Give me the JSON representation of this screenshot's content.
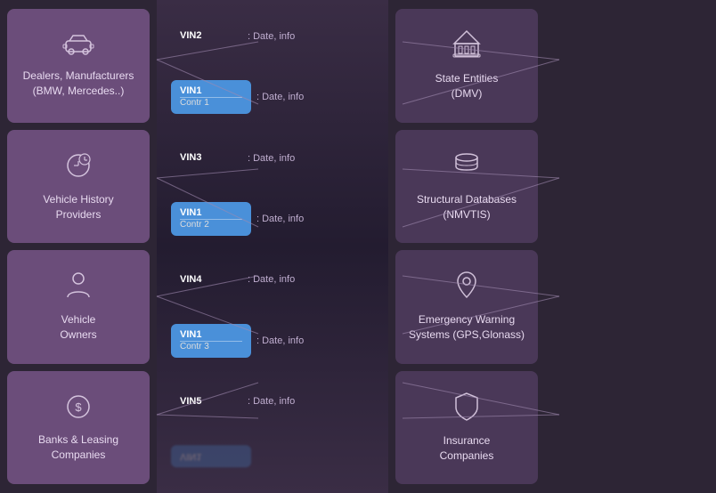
{
  "left": {
    "boxes": [
      {
        "id": "dealers",
        "icon": "🚗",
        "label": "Dealers, Manufacturers\n(BMW, Mercedes..)"
      },
      {
        "id": "vehicle-history",
        "icon": "📋",
        "label": "Vehicle History\nProviders"
      },
      {
        "id": "vehicle-owners",
        "icon": "👤",
        "label": "Vehicle\nOwners"
      },
      {
        "id": "banks",
        "icon": "💰",
        "label": "Banks & Leasing\nCompanies"
      }
    ]
  },
  "center": {
    "items": [
      {
        "id": "vin2",
        "vin": "VIN2",
        "contr": null,
        "date": ": Date, info",
        "blue": false
      },
      {
        "id": "vin1c1",
        "vin": "VIN1",
        "contr": "Contr 1",
        "date": ": Date, info",
        "blue": true
      },
      {
        "id": "vin3",
        "vin": "VIN3",
        "contr": null,
        "date": ": Date, info",
        "blue": false
      },
      {
        "id": "vin1c2",
        "vin": "VIN1",
        "contr": "Contr 2",
        "date": ": Date, info",
        "blue": true
      },
      {
        "id": "vin4",
        "vin": "VIN4",
        "contr": null,
        "date": ": Date, info",
        "blue": false
      },
      {
        "id": "vin1c3",
        "vin": "VIN1",
        "contr": "Contr 3",
        "date": ": Date, info",
        "blue": true
      },
      {
        "id": "vin5",
        "vin": "VIN5",
        "contr": null,
        "date": ": Date, info",
        "blue": false
      }
    ],
    "reflection_vin": "VIN1"
  },
  "right": {
    "boxes": [
      {
        "id": "state-entities",
        "icon": "🏛️",
        "label": "State Entities\n(DMV)"
      },
      {
        "id": "structural-db",
        "icon": "🗄️",
        "label": "Structural Databases\n(NMVTIS)"
      },
      {
        "id": "emergency",
        "icon": "📍",
        "label": "Emergency Warning\nSystems (GPS,Glonass)"
      },
      {
        "id": "insurance",
        "icon": "🛡️",
        "label": "Insurance\nCompanies"
      }
    ]
  }
}
